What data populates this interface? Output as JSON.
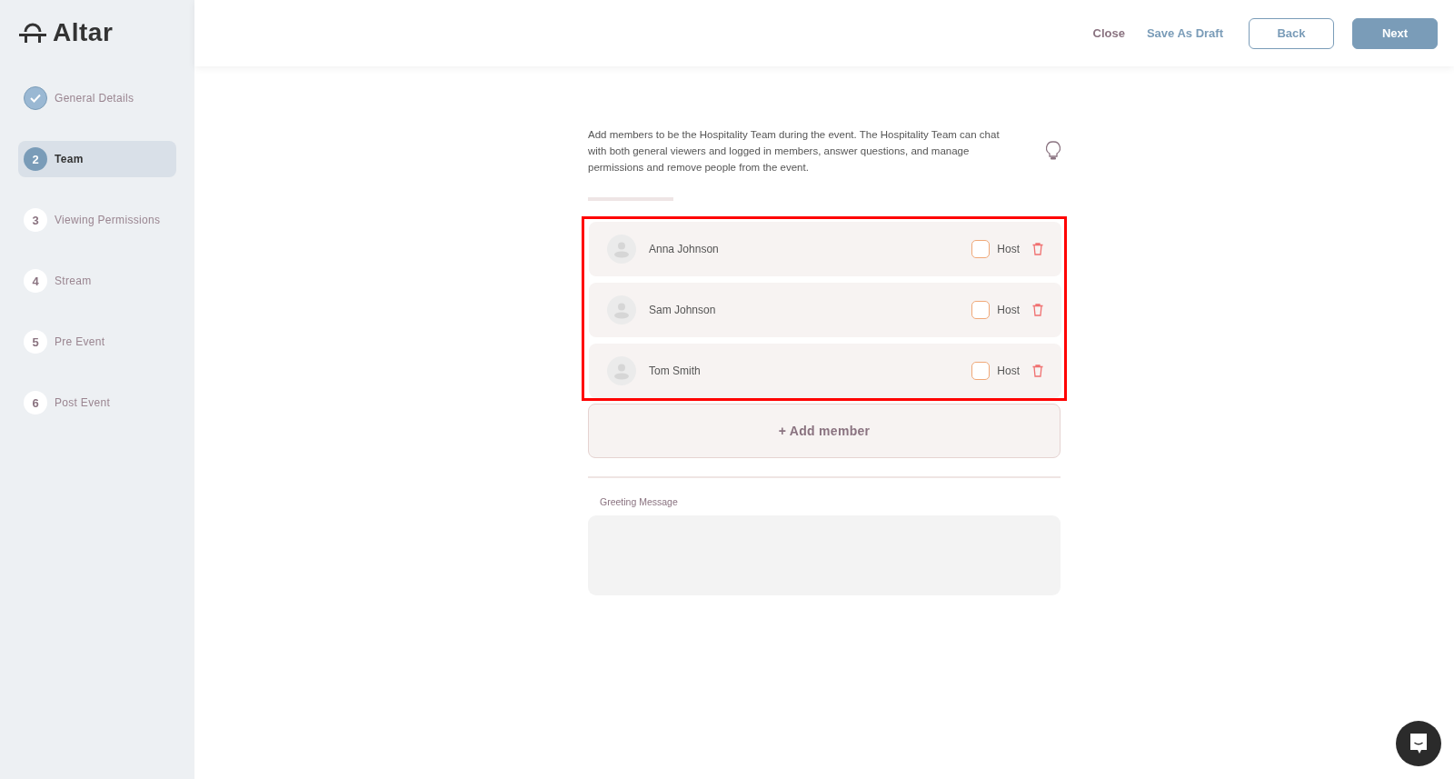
{
  "logo": {
    "text": "Altar"
  },
  "steps": [
    {
      "label": "General Details",
      "completed": true,
      "selected": false
    },
    {
      "marker": "2",
      "label": "Team",
      "completed": false,
      "selected": true
    },
    {
      "marker": "3",
      "label": "Viewing Permissions",
      "completed": false,
      "selected": false
    },
    {
      "marker": "4",
      "label": "Stream",
      "completed": false,
      "selected": false
    },
    {
      "marker": "5",
      "label": "Pre Event",
      "completed": false,
      "selected": false
    },
    {
      "marker": "6",
      "label": "Post Event",
      "completed": false,
      "selected": false
    }
  ],
  "header": {
    "close": "Close",
    "save_draft": "Save As Draft",
    "back": "Back",
    "next": "Next"
  },
  "description": "Add members to be the Hospitality Team during the event. The Hospitality Team can chat with both general viewers and logged in members, answer questions, and manage permissions and remove people from the event.",
  "members": [
    {
      "name": "Anna Johnson",
      "host_label": "Host",
      "checked": false
    },
    {
      "name": "Sam Johnson",
      "host_label": "Host",
      "checked": false
    },
    {
      "name": "Tom Smith",
      "host_label": "Host",
      "checked": false
    }
  ],
  "add_member": "+ Add member",
  "greeting": {
    "label": "Greeting Message"
  }
}
